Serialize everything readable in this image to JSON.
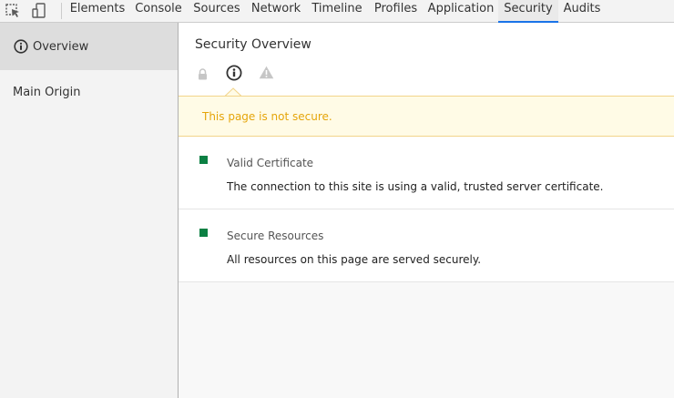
{
  "toolbar": {
    "icons": [
      "inspect-element-icon",
      "device-mode-icon"
    ],
    "tabs": [
      {
        "label": "Elements",
        "active": false
      },
      {
        "label": "Console",
        "active": false
      },
      {
        "label": "Sources",
        "active": false
      },
      {
        "label": "Network",
        "active": false
      },
      {
        "label": "Timeline",
        "active": false
      },
      {
        "label": "Profiles",
        "active": false
      },
      {
        "label": "Application",
        "active": false
      },
      {
        "label": "Security",
        "active": true
      },
      {
        "label": "Audits",
        "active": false
      }
    ],
    "accent_color": "#1a73e8"
  },
  "sidebar": {
    "items": [
      {
        "label": "Overview",
        "icon": "info-icon",
        "selected": true
      },
      {
        "label": "Main Origin",
        "selected": false
      }
    ]
  },
  "main": {
    "title": "Security Overview",
    "status_icons": [
      "lock-icon",
      "info-icon",
      "warning-icon"
    ],
    "selected_status": "info-icon",
    "banner": {
      "text": "This page is not secure.",
      "color": "#e5a50a"
    },
    "explanations": [
      {
        "title": "Valid Certificate",
        "description": "The connection to this site is using a valid, trusted server certificate.",
        "status_color": "#0b8043"
      },
      {
        "title": "Secure Resources",
        "description": "All resources on this page are served securely.",
        "status_color": "#0b8043"
      }
    ]
  }
}
